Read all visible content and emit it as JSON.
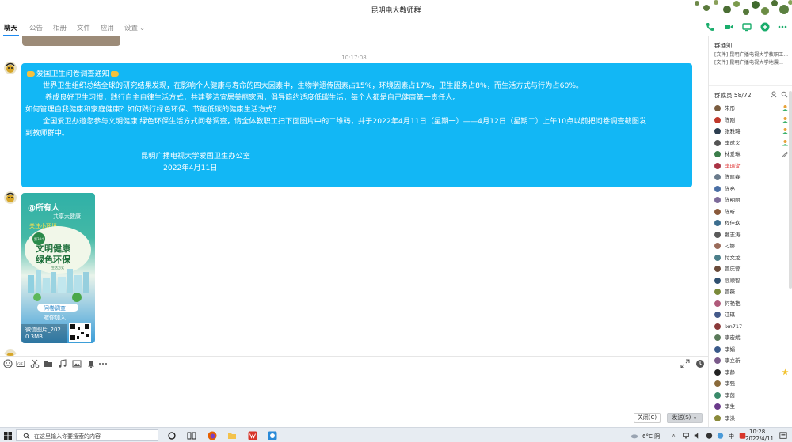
{
  "window": {
    "title": "昆明电大教师群"
  },
  "tabs": [
    {
      "label": "聊天",
      "active": true
    },
    {
      "label": "公告"
    },
    {
      "label": "相册"
    },
    {
      "label": "文件"
    },
    {
      "label": "应用"
    },
    {
      "label": "设置"
    }
  ],
  "top_actions": [
    "phone-icon",
    "video-icon",
    "screen-share-icon",
    "add-icon",
    "more-icon"
  ],
  "chat": {
    "timestamp": "10:17:08",
    "notice_message": {
      "title": "爱国卫生问卷调查通知",
      "lines": [
        "世界卫生组织总结全球的研究结果发现，在影响个人健康与寿命的四大因素中，生物学遗传因素占15%，环境因素占17%，卫生服务占8%，而生活方式与行为占60%。",
        "养成良好卫生习惯，践行自主自律生活方式，共建整洁宜居美丽家园，倡导简约适度低碳生活，每个人都是自己健康第一责任人。",
        "如何管理自我健康和家庭健康？如何践行绿色环保、节能低碳的健康生活方式？",
        "全国爱卫办邀您参与文明健康 绿色环保生活方式问卷调查，请全体教职工扫下面图片中的二维码，并于2022年4月11日（星期一）——4月12日（星期二）上午10点以前把问卷调查截图发",
        "到教师群中。"
      ],
      "signature": "昆明广播电视大学爱国卫生办公室",
      "date": "2022年4月11日"
    },
    "image_message": {
      "poster_heading": "@所有人",
      "poster_sub": "共享大健康",
      "poster_sub2": "关注小环境",
      "poster_title1": "文明健康",
      "poster_title2": "绿色环保",
      "poster_small": "生活方式",
      "poster_btn1": "问卷调查",
      "poster_btn2": "邀你加入",
      "poster_badge": "第34个",
      "filename": "微信图片_202...",
      "filesize": "0.3MB"
    }
  },
  "toolbar_icons": [
    "emoji-icon",
    "gif-icon",
    "scissors-icon",
    "folder-icon",
    "music-icon",
    "image-icon",
    "bell-icon",
    "more-icon"
  ],
  "buttons": {
    "close": "关闭(C)",
    "send": "发送(S)"
  },
  "rightpanel": {
    "notice_title": "群通知",
    "notices": [
      "[文件] 昆明广播电视大学教职工...",
      "[文件] 昆明广播电视大学地震..."
    ],
    "members_title": "群成员 58/72",
    "members": [
      {
        "name": "朱彤",
        "color": "#7a5c3f",
        "role": "admin"
      },
      {
        "name": "陈刚",
        "color": "#c0392b",
        "role": "admin"
      },
      {
        "name": "张雅璐",
        "color": "#2d3e50",
        "role": "admin"
      },
      {
        "name": "李成义",
        "color": "#555",
        "role": "admin"
      },
      {
        "name": "林爱琳",
        "color": "#3b7d4a",
        "role": "edit"
      },
      {
        "name": "李瑞汶",
        "color": "#a34",
        "red": true
      },
      {
        "name": "陈建春",
        "color": "#6a7b8c"
      },
      {
        "name": "陈亮",
        "color": "#4a6fa5"
      },
      {
        "name": "陈明丽",
        "color": "#7d6b9a"
      },
      {
        "name": "陈昕",
        "color": "#8a5a3b"
      },
      {
        "name": "程佳玖",
        "color": "#3c6e8f"
      },
      {
        "name": "戴志涛",
        "color": "#5a5a5a"
      },
      {
        "name": "刁娜",
        "color": "#9a6b5a"
      },
      {
        "name": "付文龙",
        "color": "#4b7f8a"
      },
      {
        "name": "管庆蓉",
        "color": "#6a4b3a"
      },
      {
        "name": "高顺智",
        "color": "#2f4f6f"
      },
      {
        "name": "管薇",
        "color": "#7a8a3a"
      },
      {
        "name": "何艳艳",
        "color": "#b05a7a"
      },
      {
        "name": "江琪",
        "color": "#445a8a"
      },
      {
        "name": "lxn717",
        "color": "#8a3a3a"
      },
      {
        "name": "李宏斌",
        "color": "#5a7a5a"
      },
      {
        "name": "李娟",
        "color": "#3a5a8a"
      },
      {
        "name": "李立新",
        "color": "#7a5a8a"
      },
      {
        "name": "李静",
        "color": "#222",
        "role": "star"
      },
      {
        "name": "李强",
        "color": "#8a6a3a"
      },
      {
        "name": "李茵",
        "color": "#3a8a6a"
      },
      {
        "name": "李生",
        "color": "#6a3a8a"
      },
      {
        "name": "李洪",
        "color": "#8a8a3a"
      }
    ]
  },
  "taskbar": {
    "search_placeholder": "在这里输入你要搜索的内容",
    "weather": "6°C 阴",
    "time": "10:28",
    "date": "2022/4/11",
    "ime": "中"
  },
  "colors": {
    "bubble": "#12b7f5",
    "accent": "#1e8af0",
    "green": "#1aad6c"
  }
}
